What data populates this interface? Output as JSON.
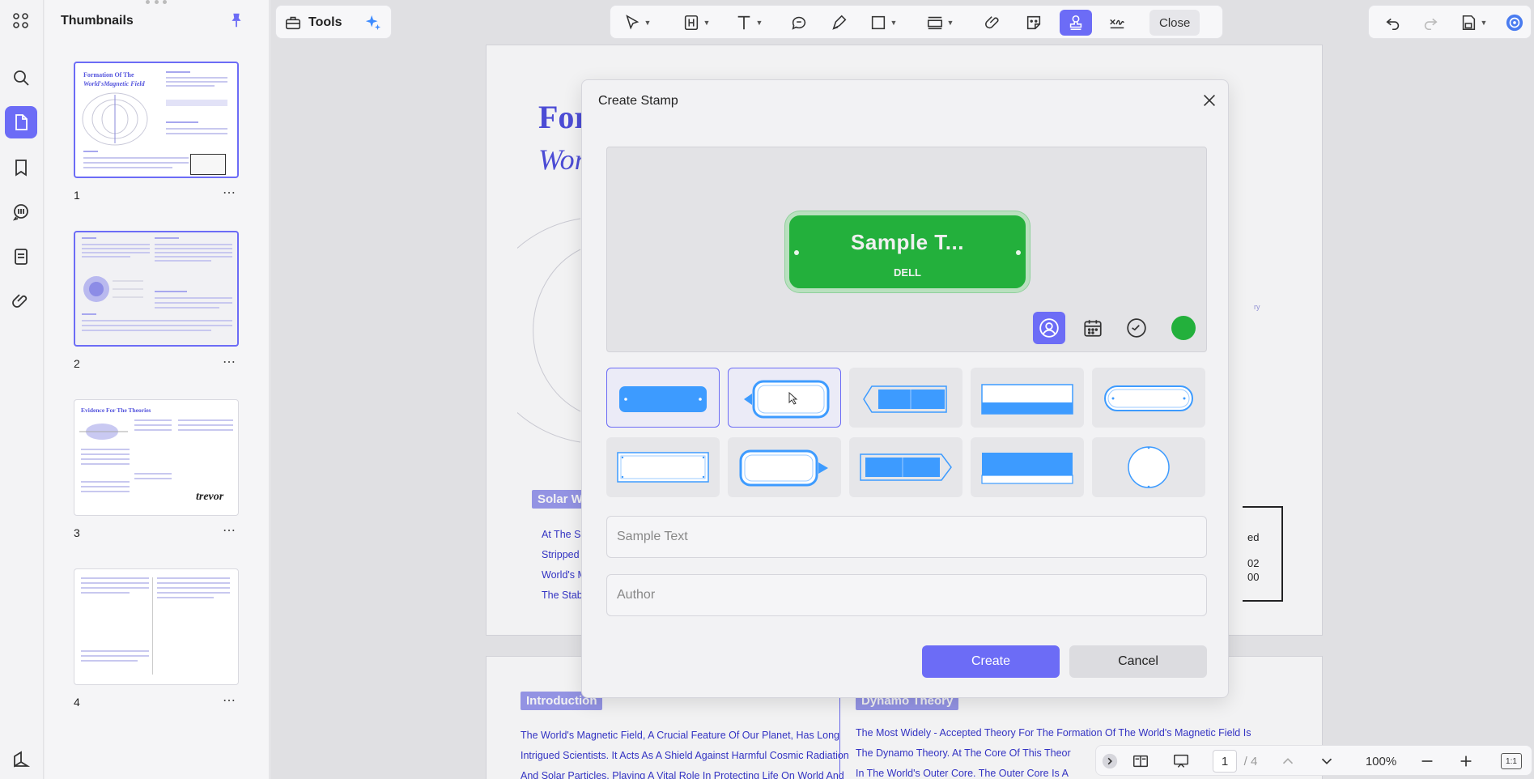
{
  "thumbnails": {
    "title": "Thumbnails",
    "pages": [
      {
        "number": "1",
        "title_line1": "Formation Of The",
        "title_line2": "World'sMagnetic Field"
      },
      {
        "number": "2"
      },
      {
        "number": "3",
        "title_line1": "Evidence For The Theories",
        "signature": "trevor"
      },
      {
        "number": "4"
      }
    ],
    "more_label": "⋯"
  },
  "toolbar": {
    "tools_label": "Tools",
    "close_label": "Close"
  },
  "document": {
    "title_partial": "For",
    "subtitle_partial": "Wor",
    "solar_tag": "Solar W",
    "solar_lines": [
      "At The Sa",
      "Stripped",
      "World's M",
      "The Stabi"
    ],
    "intro_tag": "Introduction",
    "intro_lines": [
      "The World's Magnetic Field, A Crucial Feature Of Our Planet, Has Long",
      "Intrigued Scientists. It Acts As A Shield Against Harmful Cosmic Radiation",
      "And Solar Particles, Playing A Vital Role In Protecting Life On World And"
    ],
    "dynamo_tag": "Dynamo Theory",
    "dynamo_lines": [
      "The Most Widely - Accepted Theory For The Formation Of The World's Magnetic Field Is",
      "The Dynamo Theory. At The Core Of This Theor",
      "In The World's Outer Core. The Outer Core Is A"
    ],
    "right_frag": [
      "ed",
      "02",
      "00"
    ],
    "ry_frag": "ry"
  },
  "modal": {
    "title": "Create Stamp",
    "stamp_text": "Sample T...",
    "stamp_author": "DELL",
    "stamp_color": "#23b03c",
    "sample_text_placeholder": "Sample Text",
    "author_placeholder": "Author",
    "create_label": "Create",
    "cancel_label": "Cancel"
  },
  "statusbar": {
    "current_page": "1",
    "total_pages": "/ 4",
    "zoom": "100%",
    "fit_label": "1:1"
  },
  "colors": {
    "accent": "#6c6cf6",
    "stamp_green": "#23b03c",
    "shape_blue": "#3d9bff"
  }
}
